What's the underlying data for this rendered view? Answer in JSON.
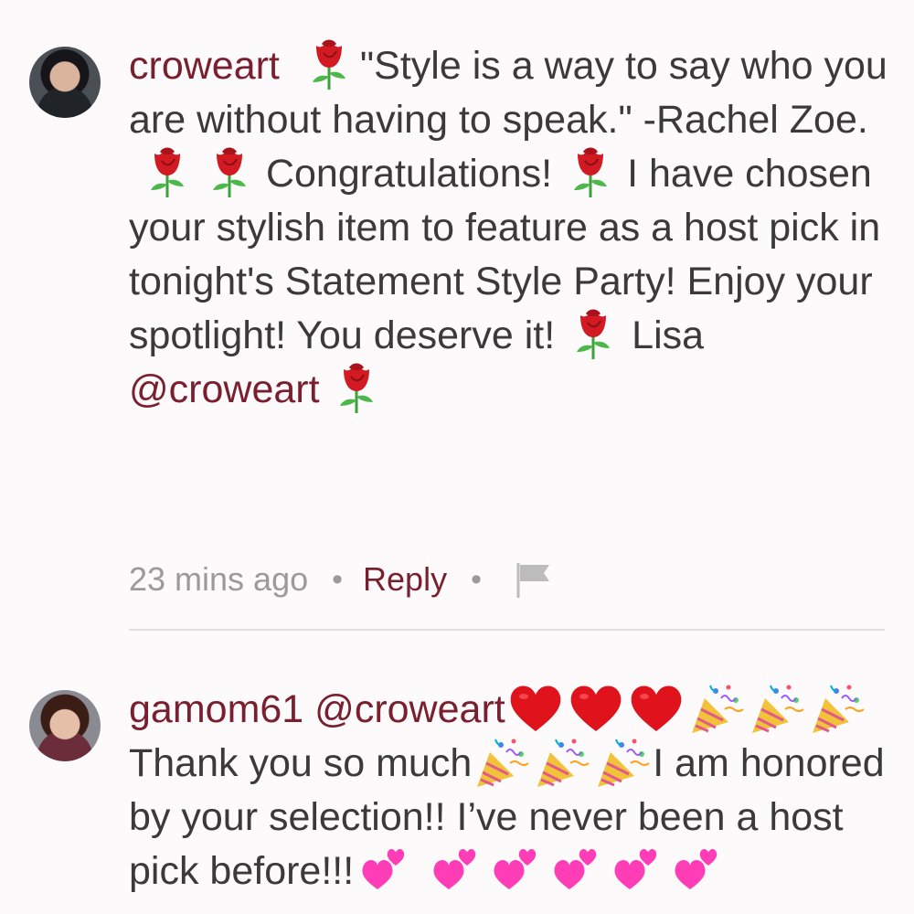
{
  "comments": [
    {
      "username": "croweart",
      "text_1": "\"Style is a way to say who you are without having to speak.\" -Rachel Zoe.",
      "text_2": "Congratulations!",
      "text_3": "I have chosen your stylish item to feature as a host pick in tonight's Statement Style Party! Enjoy your spotlight! You deserve it!",
      "text_4": "Lisa",
      "mention": "@croweart",
      "time": "23 mins ago",
      "reply_label": "Reply",
      "separator": "•"
    },
    {
      "username": "gamom61",
      "mention": "@croweart",
      "text_1": "Thank you so much",
      "text_2": "I am honored by your selection!! I’ve never been a host pick before!!!"
    }
  ],
  "icons": {
    "rose": "rose-emoji",
    "heart": "red-heart-emoji",
    "popper": "party-popper-emoji",
    "pink_heart": "two-hearts-emoji",
    "flag": "flag-icon"
  },
  "colors": {
    "accent": "#7a1f2e",
    "meta_text": "#9a9a9a",
    "body_text": "#3a3a3a",
    "background": "#fcfafb"
  }
}
